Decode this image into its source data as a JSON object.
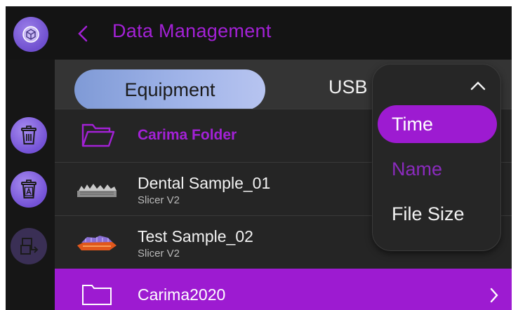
{
  "header": {
    "title": "Data Management"
  },
  "tabs": [
    {
      "label": "Equipment",
      "active": true
    },
    {
      "label": "USB",
      "active": false
    }
  ],
  "sort_menu": {
    "options": [
      {
        "label": "Time",
        "state": "selected"
      },
      {
        "label": "Name",
        "state": "highlighted"
      },
      {
        "label": "File Size",
        "state": "normal"
      }
    ]
  },
  "files": [
    {
      "type": "folder",
      "name": "Carima Folder"
    },
    {
      "type": "file",
      "name": "Dental Sample_01",
      "subtitle": "Slicer V2"
    },
    {
      "type": "file",
      "name": "Test Sample_02",
      "subtitle": "Slicer V2"
    },
    {
      "type": "folder",
      "name": "Carima2020",
      "selected": true
    }
  ],
  "colors": {
    "accent": "#9d1bd1",
    "title": "#a321d6",
    "tab_gradient_start": "#7f9ad6",
    "tab_gradient_end": "#b7c4f0",
    "background": "#242424"
  },
  "sidebar": {
    "items": [
      {
        "icon": "trash-icon",
        "state": "active"
      },
      {
        "icon": "trash-all-icon",
        "state": "active"
      },
      {
        "icon": "export-icon",
        "state": "disabled"
      }
    ]
  }
}
